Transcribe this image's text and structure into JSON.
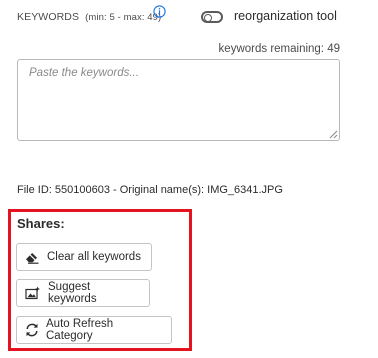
{
  "keywords": {
    "label": "KEYWORDS",
    "minmax": "(min: 5 - max: 49)",
    "remaining": "keywords remaining: 49",
    "placeholder": "Paste the keywords..."
  },
  "toggle": {
    "label": "reorganization tool",
    "state": "off"
  },
  "file": {
    "info": "File ID: 550100603 - Original name(s): IMG_6341.JPG"
  },
  "shares": {
    "title": "Shares:",
    "buttons": [
      {
        "label": "Clear all keywords",
        "icon": "eraser-icon"
      },
      {
        "label": "Suggest keywords",
        "icon": "image-sparkle-icon"
      },
      {
        "label": "Auto Refresh Category",
        "icon": "refresh-icon"
      }
    ]
  },
  "colors": {
    "accent_blue": "#1473e6",
    "highlight_red": "#e3131f"
  }
}
